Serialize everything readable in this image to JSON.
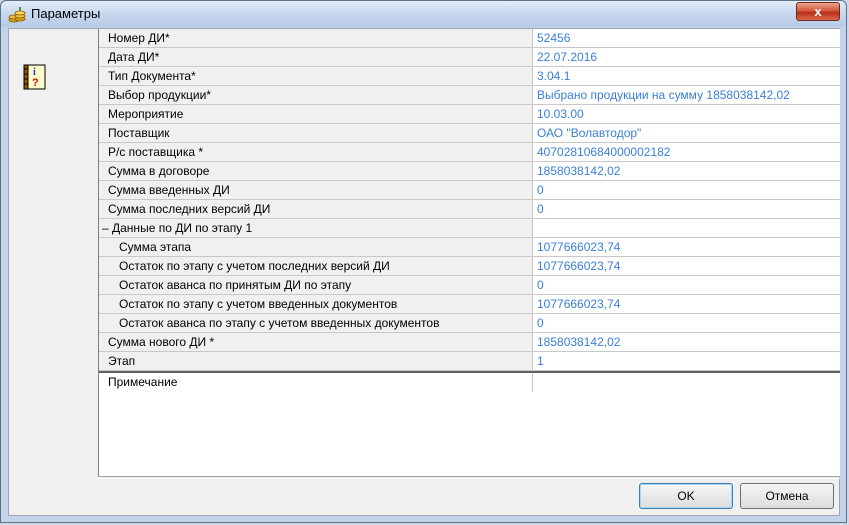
{
  "window": {
    "title": "Параметры",
    "close_symbol": "x"
  },
  "icons": {
    "app": "coins-icon",
    "info": "info-book-icon"
  },
  "rows": [
    {
      "name": "Номер ДИ*",
      "value": "52456",
      "kind": "field"
    },
    {
      "name": "Дата ДИ*",
      "value": "22.07.2016",
      "kind": "field"
    },
    {
      "name": "Тип Документа*",
      "value": "3.04.1",
      "kind": "field"
    },
    {
      "name": "Выбор продукции*",
      "value": "Выбрано продукции на сумму 1858038142,02",
      "kind": "field"
    },
    {
      "name": "Мероприятие",
      "value": "10.03.00",
      "kind": "field"
    },
    {
      "name": "Поставщик",
      "value": "ОАО \"Волавтодор\"",
      "kind": "field"
    },
    {
      "name": "Р/с поставщика *",
      "value": "40702810684000002182",
      "kind": "field"
    },
    {
      "name": "Сумма в договоре",
      "value": "1858038142,02",
      "kind": "field"
    },
    {
      "name": "Сумма введенных ДИ",
      "value": "0",
      "kind": "field"
    },
    {
      "name": "Сумма последних версий ДИ",
      "value": "0",
      "kind": "field"
    },
    {
      "name": "– Данные по ДИ по этапу 1",
      "value": "",
      "kind": "group"
    },
    {
      "name": "Сумма этапа",
      "value": "1077666023,74",
      "kind": "sub"
    },
    {
      "name": "Остаток по этапу с учетом последних версий ДИ",
      "value": "1077666023,74",
      "kind": "sub"
    },
    {
      "name": "Остаток аванса по принятым ДИ по этапу",
      "value": "0",
      "kind": "sub"
    },
    {
      "name": "Остаток по этапу с учетом введенных документов",
      "value": "1077666023,74",
      "kind": "sub"
    },
    {
      "name": "Остаток аванса по этапу с учетом введенных документов",
      "value": "0",
      "kind": "sub"
    },
    {
      "name": "Сумма нового ДИ *",
      "value": "1858038142,02",
      "kind": "field"
    },
    {
      "name": "Этап",
      "value": "1",
      "kind": "field"
    },
    {
      "name": "Примечание",
      "value": "",
      "kind": "note"
    }
  ],
  "buttons": {
    "ok": "OK",
    "cancel": "Отмена"
  },
  "colors": {
    "value_text": "#3a7fd5",
    "title_bar": "#c9d9ef",
    "close_button": "#c8462c"
  }
}
